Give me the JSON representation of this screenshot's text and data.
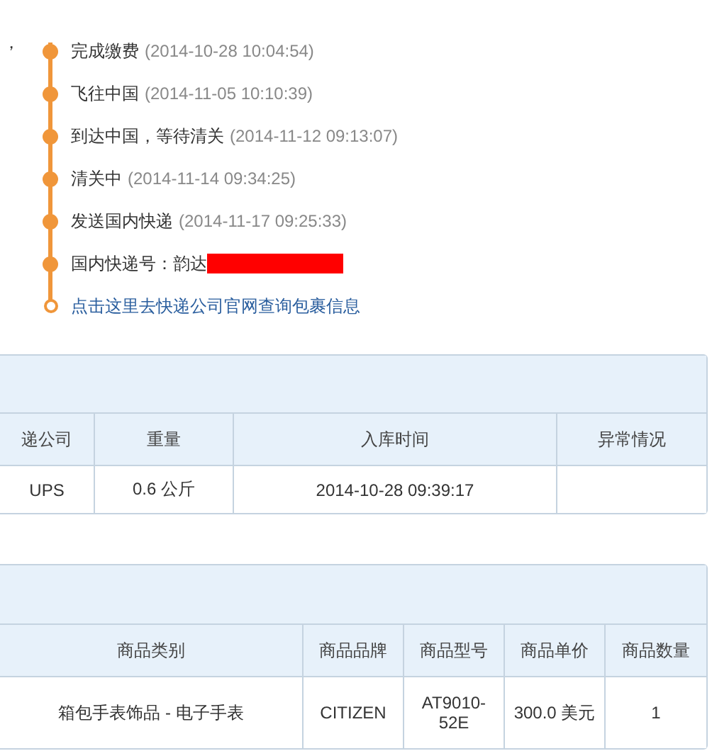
{
  "intro_fragment": "，",
  "timeline": [
    {
      "kind": "event",
      "label": "完成缴费",
      "time": "(2014-10-28 10:04:54)"
    },
    {
      "kind": "event",
      "label": "飞往中国",
      "time": "(2014-11-05 10:10:39)"
    },
    {
      "kind": "event",
      "label": "到达中国，等待清关",
      "time": "(2014-11-12 09:13:07)"
    },
    {
      "kind": "event",
      "label": "清关中",
      "time": "(2014-11-14 09:34:25)"
    },
    {
      "kind": "event",
      "label": "发送国内快递",
      "time": "(2014-11-17 09:25:33)"
    },
    {
      "kind": "redacted",
      "label": "国内快递号：韵达"
    },
    {
      "kind": "link",
      "label": "点击这里去快递公司官网查询包裹信息"
    }
  ],
  "tables": [
    {
      "columns": [
        "递公司",
        "重量",
        "入库时间",
        "异常情况"
      ],
      "rows": [
        [
          "UPS",
          "0.6 公斤",
          "2014-10-28 09:39:17",
          ""
        ]
      ]
    },
    {
      "columns": [
        "商品类别",
        "商品品牌",
        "商品型号",
        "商品单价",
        "商品数量"
      ],
      "rows": [
        [
          "箱包手表饰品 - 电子手表",
          "CITIZEN",
          "AT9010-52E",
          "300.0 美元",
          "1"
        ]
      ]
    }
  ]
}
